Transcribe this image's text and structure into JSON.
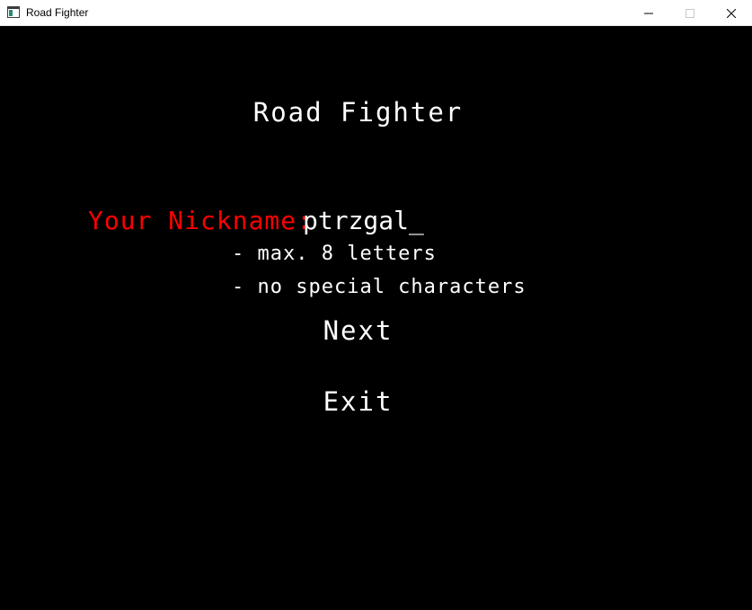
{
  "window": {
    "title": "Road Fighter",
    "icon": "app-window-icon"
  },
  "game": {
    "title": "Road Fighter",
    "nickname_label": "Your Nickname:",
    "nickname_value": "ptrzgal_",
    "hints": [
      "- max. 8 letters",
      "- no special characters"
    ],
    "menu": {
      "next": "Next",
      "exit": "Exit"
    }
  },
  "colors": {
    "background": "#000000",
    "text": "#ffffff",
    "accent": "#ff0000",
    "titlebar": "#ffffff"
  }
}
